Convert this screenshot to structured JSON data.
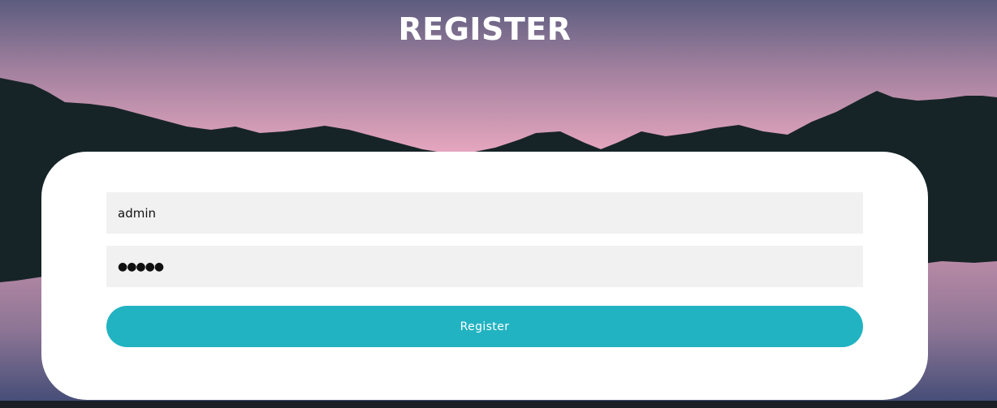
{
  "page": {
    "title": "REGISTER"
  },
  "form": {
    "username_value": "admin",
    "password_masked": "●●●●●",
    "submit_label": "Register"
  },
  "colors": {
    "accent": "#22b3c2",
    "field_bg": "#f1f1f1",
    "card_bg": "#ffffff",
    "mountain": "#172427"
  }
}
